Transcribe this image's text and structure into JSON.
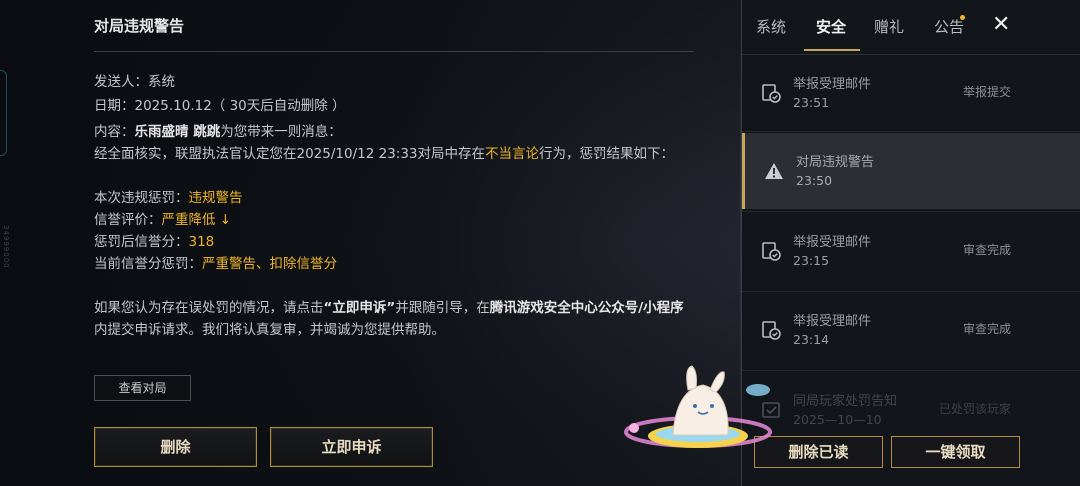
{
  "mail": {
    "title": "对局违规警告",
    "sender_label": "发送人：",
    "sender": "系统",
    "date_label": "日期：",
    "date": "2025.10.12",
    "date_note": "（ 30天后自动删除 ）",
    "content_label": "内容：",
    "players": "乐雨盛晴 跳跳",
    "content_intro_suffix": "为您带来一则消息：",
    "verify_prefix": "经全面核实，联盟执法官认定您在2025/10/12 23:33对局中存在",
    "verify_highlight": "不当言论",
    "verify_suffix": "行为，惩罚结果如下：",
    "penalty_label": "本次违规惩罚：",
    "penalty_value": "违规警告",
    "rating_label": "信誉评价：",
    "rating_value": "严重降低 ↓",
    "score_label": "惩罚后信誉分：",
    "score_value": "318",
    "current_label": "当前信誉分惩罚：",
    "current_value": "严重警告、扣除信誉分",
    "appeal_prefix": "如果您认为存在误处罚的情况，请点击",
    "appeal_button_ref": "“立即申诉”",
    "appeal_middle": "并跟随引导，在",
    "appeal_channel": "腾讯游戏安全中心公众号/小程序",
    "appeal_line2": "内提交申诉请求。我们将认真复审，并竭诚为您提供帮助。",
    "view_match_label": "查看对局",
    "delete_label": "删除",
    "appeal_label": "立即申诉"
  },
  "side_number": "34999000",
  "tabs": [
    {
      "label": "系统"
    },
    {
      "label": "安全"
    },
    {
      "label": "赠礼"
    },
    {
      "label": "公告"
    }
  ],
  "active_tab": "安全",
  "mail_list": [
    {
      "title": "举报受理邮件",
      "time": "23:51",
      "status": "举报提交",
      "icon": "report-check-icon"
    },
    {
      "title": "对局违规警告",
      "time": "23:50",
      "status": "",
      "icon": "warning-icon",
      "selected": true
    },
    {
      "title": "举报受理邮件",
      "time": "23:15",
      "status": "审查完成",
      "icon": "report-check-icon"
    },
    {
      "title": "举报受理邮件",
      "time": "23:14",
      "status": "审查完成",
      "icon": "report-check-icon"
    },
    {
      "title": "同局玩家处罚告知",
      "time": "2025—10—10",
      "status": "已处罚该玩家",
      "icon": "notice-icon"
    }
  ],
  "actions": {
    "delete_read": "删除已读",
    "claim_all": "一键领取"
  },
  "colors": {
    "highlight": "#f0b429",
    "gold_border": "#b48a3c",
    "panel_bg": "#121519"
  }
}
